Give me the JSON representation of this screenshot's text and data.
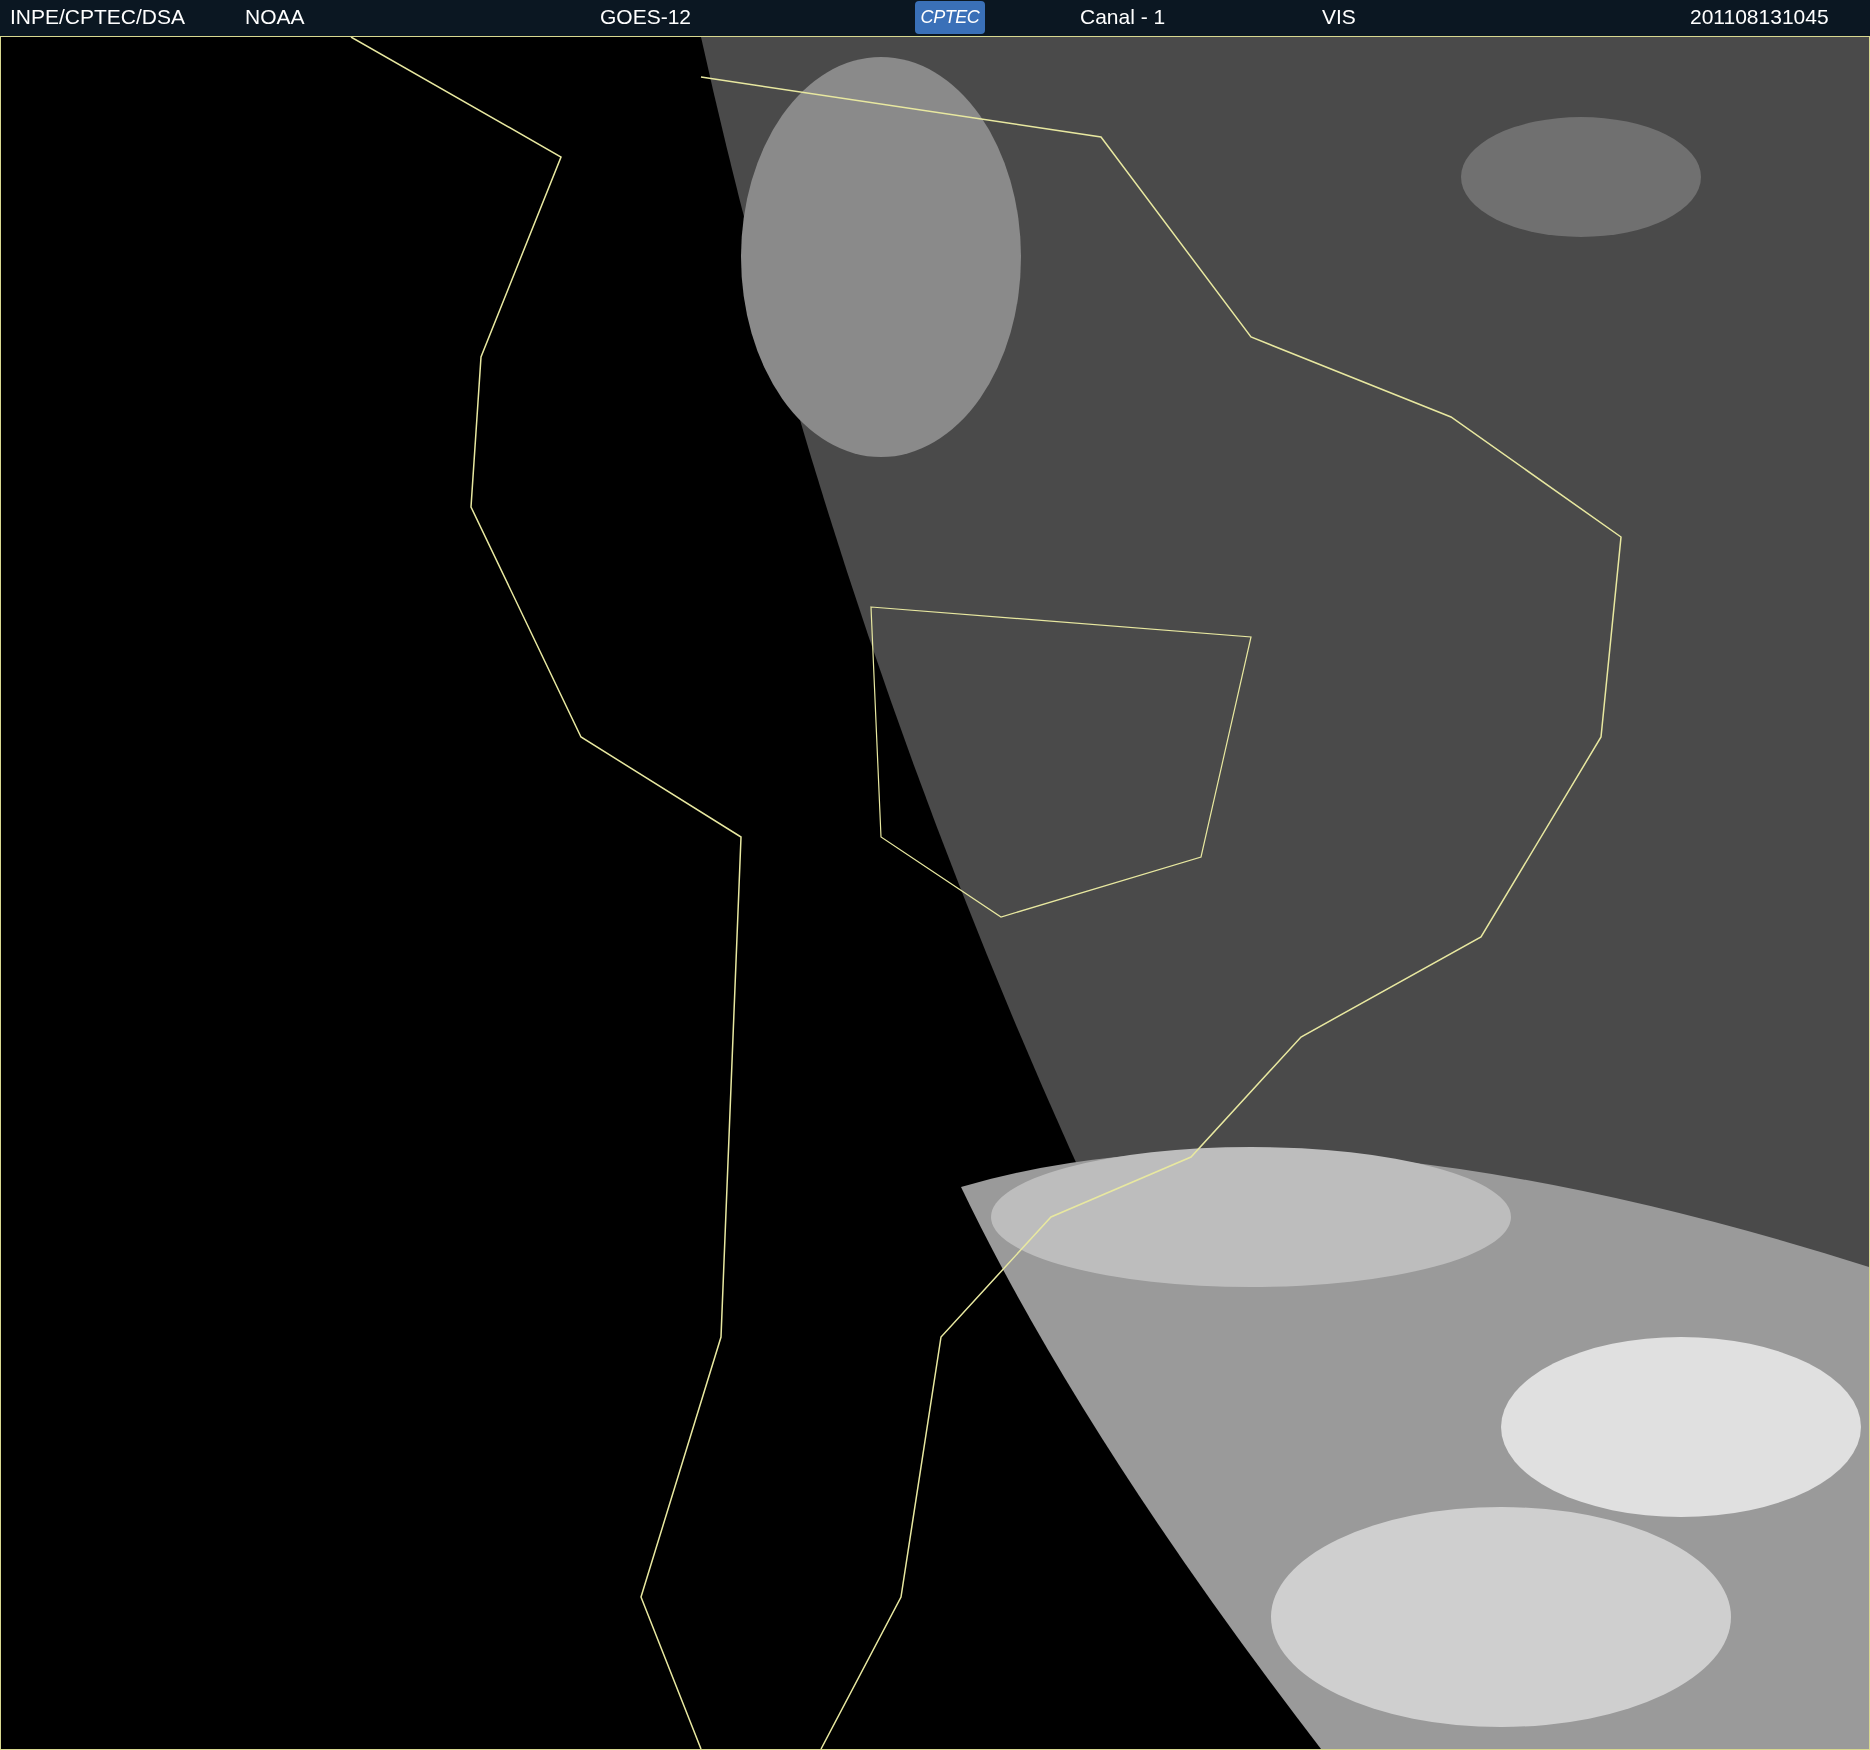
{
  "header": {
    "items": [
      {
        "kind": "text",
        "text": "INPE/CPTEC/DSA"
      },
      {
        "kind": "text",
        "text": "NOAA"
      },
      {
        "kind": "text",
        "text": "GOES-12"
      },
      {
        "kind": "logo",
        "text": "CPTEC"
      },
      {
        "kind": "text",
        "text": "Canal - 1"
      },
      {
        "kind": "text",
        "text": "VIS"
      },
      {
        "kind": "text",
        "text": "201108131045"
      }
    ]
  }
}
